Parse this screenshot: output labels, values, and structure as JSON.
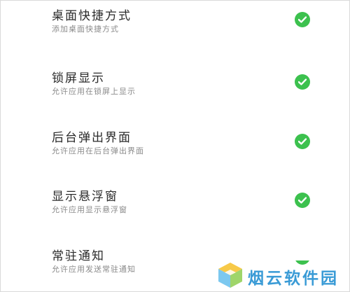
{
  "theme": {
    "accent": "#3cc14e",
    "watermark_color": "#3a9bd6"
  },
  "permissions": [
    {
      "title": "桌面快捷方式",
      "subtitle": "添加桌面快捷方式",
      "enabled": true,
      "icon": "check-circle-icon"
    },
    {
      "title": "锁屏显示",
      "subtitle": "允许应用在锁屏上显示",
      "enabled": true,
      "icon": "check-circle-icon"
    },
    {
      "title": "后台弹出界面",
      "subtitle": "允许应用在后台弹出界面",
      "enabled": true,
      "icon": "check-circle-icon"
    },
    {
      "title": "显示悬浮窗",
      "subtitle": "允许应用显示悬浮窗",
      "enabled": true,
      "icon": "check-circle-icon"
    },
    {
      "title": "常驻通知",
      "subtitle": "允许应用发送常驻通知",
      "enabled": true,
      "icon": "check-circle-icon"
    }
  ],
  "watermark": {
    "text": "烟云软件园",
    "icon": "cube-logo-icon"
  }
}
